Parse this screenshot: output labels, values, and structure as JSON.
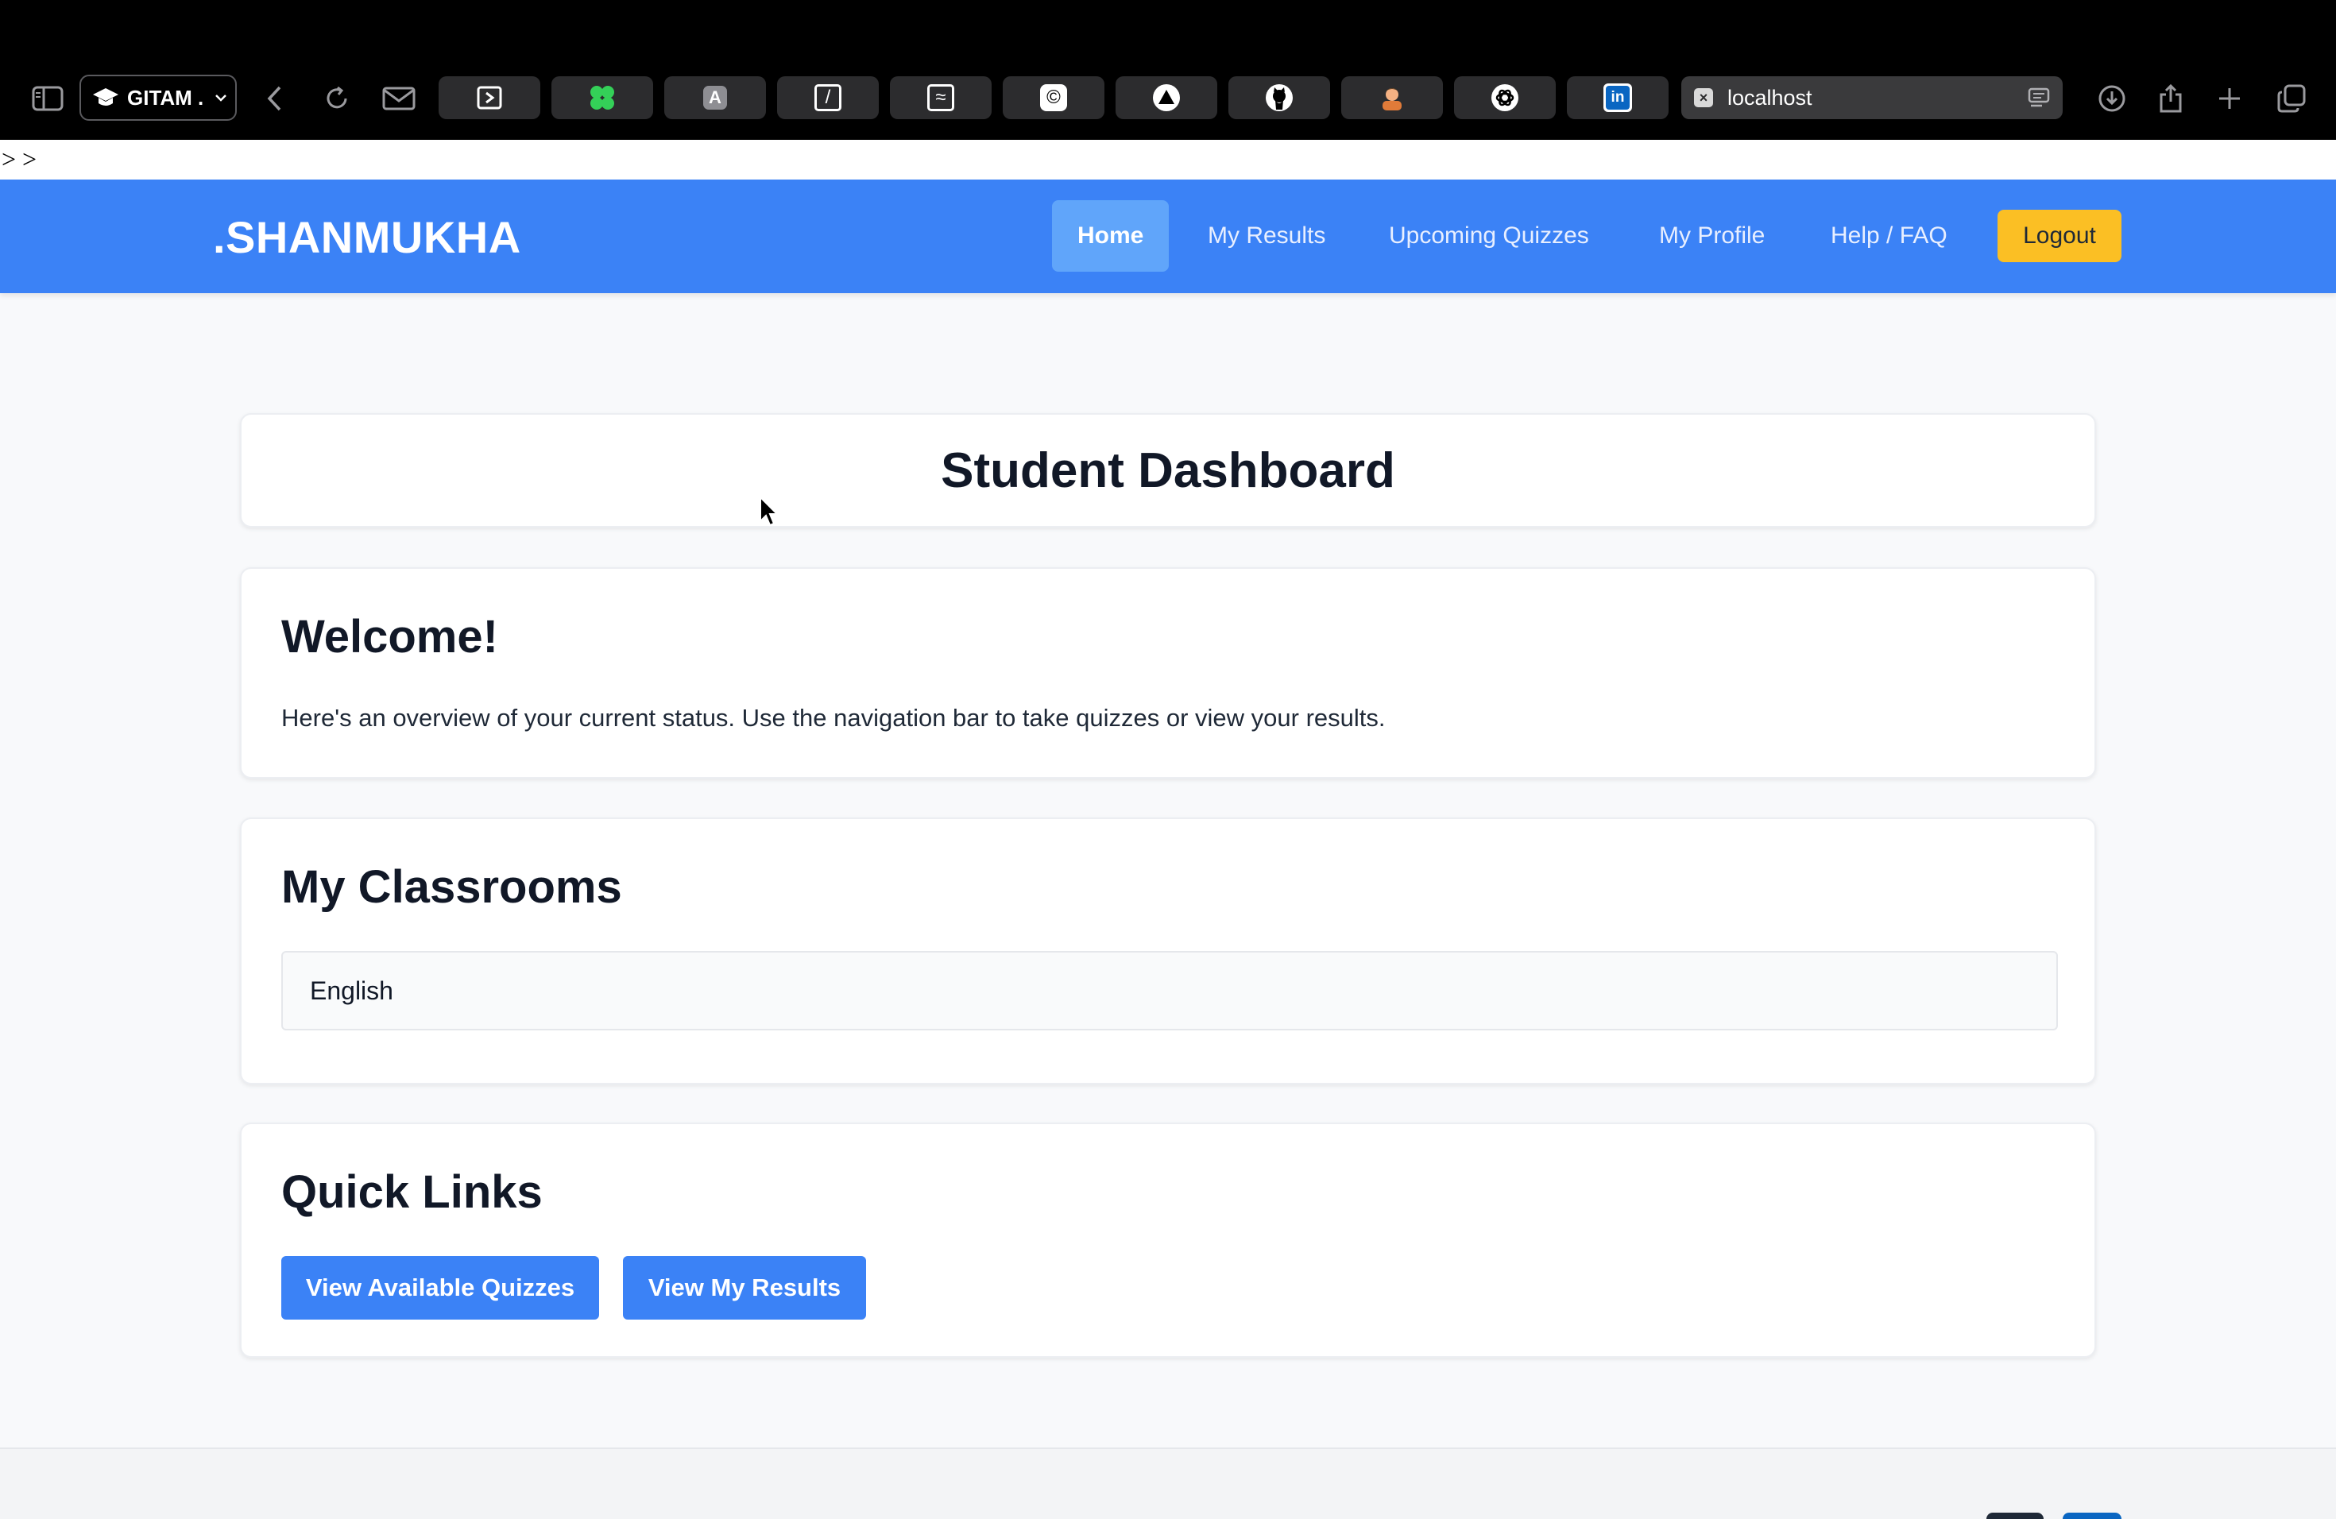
{
  "browser": {
    "profile_label": "GITAM .",
    "address": "localhost",
    "favicon_label": "×",
    "tabs": [
      {
        "icon": "cursor-app-icon"
      },
      {
        "icon": "clover-icon",
        "color": "#34d058"
      },
      {
        "icon": "letter-a-icon",
        "glyph": "A"
      },
      {
        "icon": "slash-icon",
        "glyph": "/"
      },
      {
        "icon": "wave-icon",
        "glyph": "≈"
      },
      {
        "icon": "copyright-icon",
        "glyph": "©"
      },
      {
        "icon": "triangle-icon"
      },
      {
        "icon": "github-icon"
      },
      {
        "icon": "avatar-icon"
      },
      {
        "icon": "openai-icon"
      },
      {
        "icon": "linkedin-icon",
        "glyph": "in",
        "color": "#0a66c2"
      }
    ]
  },
  "breadcrumb": "> >",
  "navbar": {
    "brand": ".SHANMUKHA",
    "links": [
      "Home",
      "My Results",
      "Upcoming Quizzes",
      "My Profile",
      "Help / FAQ"
    ],
    "active": "Home",
    "logout": "Logout"
  },
  "page": {
    "title": "Student Dashboard",
    "welcome": {
      "heading": "Welcome!",
      "text": "Here's an overview of your current status. Use the navigation bar to take quizzes or view your results."
    },
    "classrooms": {
      "heading": "My Classrooms",
      "items": [
        "English"
      ]
    },
    "quick_links": {
      "heading": "Quick Links",
      "buttons": [
        "View Available Quizzes",
        "View My Results"
      ]
    }
  },
  "colors": {
    "primary": "#3b82f6",
    "accent": "#fbbf24",
    "active_link": "#60a5fa"
  }
}
